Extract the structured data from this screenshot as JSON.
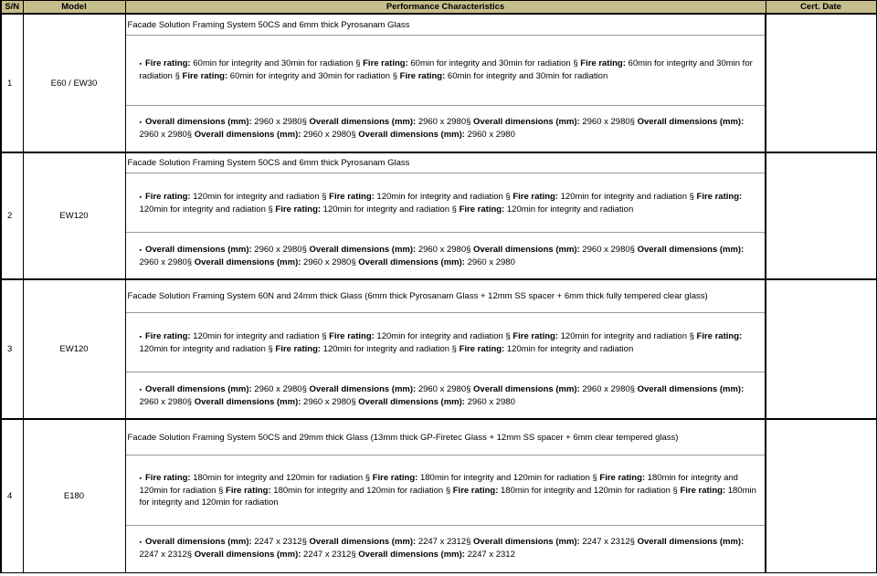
{
  "headers": {
    "sn": "S/N",
    "model": "Model",
    "perf": "Performance Characteristics",
    "cert": "Cert. Date"
  },
  "rows": [
    {
      "sn": "1",
      "model": "E60 / EW30",
      "title": "Facade Solution Framing System 50CS and 6mm thick Pyrosanam Glass",
      "fire_label": "Fire rating:",
      "fire_value": "60min for integrity and 30min for radiation",
      "fire_count": 5,
      "dims_label": "Overall dimensions (mm):",
      "dims_value": "2960 x 2980",
      "dims_count": 6
    },
    {
      "sn": "2",
      "model": "EW120",
      "title": "Facade Solution Framing System 50CS and 6mm thick Pyrosanam Glass",
      "fire_label": "Fire rating:",
      "fire_value": "120min for integrity and radiation",
      "fire_count": 6,
      "dims_label": "Overall dimensions (mm):",
      "dims_value": "2960 x 2980",
      "dims_count": 6
    },
    {
      "sn": "3",
      "model": "EW120",
      "title": "Facade Solution Framing System 60N and 24mm thick Glass (6mm thick Pyrosanam Glass + 12mm SS spacer + 6mm thick fully tempered clear glass)",
      "fire_label": "Fire rating:",
      "fire_value": "120min for integrity and radiation",
      "fire_count": 6,
      "dims_label": "Overall dimensions (mm):",
      "dims_value": "2960 x 2980",
      "dims_count": 6
    },
    {
      "sn": "4",
      "model": "E180",
      "title": "Facade Solution Framing System 50CS  and 29mm thick Glass (13mm thick GP-Firetec Glass + 12mm SS spacer + 6mm clear tempered glass)",
      "fire_label": "Fire rating:",
      "fire_value": "180min for integrity and 120min for radiation",
      "fire_count": 6,
      "dims_label": "Overall dimensions (mm):",
      "dims_value": "2247 x 2312",
      "dims_count": 6
    }
  ],
  "separator": "§"
}
